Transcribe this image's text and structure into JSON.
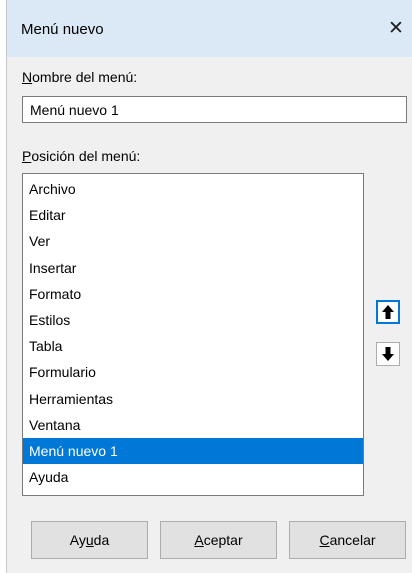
{
  "dialog": {
    "title": "Menú nuevo",
    "close_glyph": "✕"
  },
  "name_field": {
    "label_mnemonic": "N",
    "label_rest": "ombre del menú:",
    "value": "Menú nuevo 1"
  },
  "position": {
    "label_mnemonic": "P",
    "label_rest": "osición del menú:",
    "items": [
      "Archivo",
      "Editar",
      "Ver",
      "Insertar",
      "Formato",
      "Estilos",
      "Tabla",
      "Formulario",
      "Herramientas",
      "Ventana",
      "Menú nuevo 1",
      "Ayuda"
    ],
    "selected_item": "Menú nuevo 1",
    "move_up_icon": "arrow-up-icon",
    "move_down_icon": "arrow-down-icon"
  },
  "buttons": {
    "help_pre": "Ay",
    "help_mnemonic": "u",
    "help_post": "da",
    "ok_mnemonic": "A",
    "ok_rest": "ceptar",
    "cancel_mnemonic": "C",
    "cancel_rest": "ancelar"
  },
  "colors": {
    "titlebar": "#dbe8f5",
    "selection": "#0078d7",
    "dialog_bg": "#f0f0f0"
  }
}
